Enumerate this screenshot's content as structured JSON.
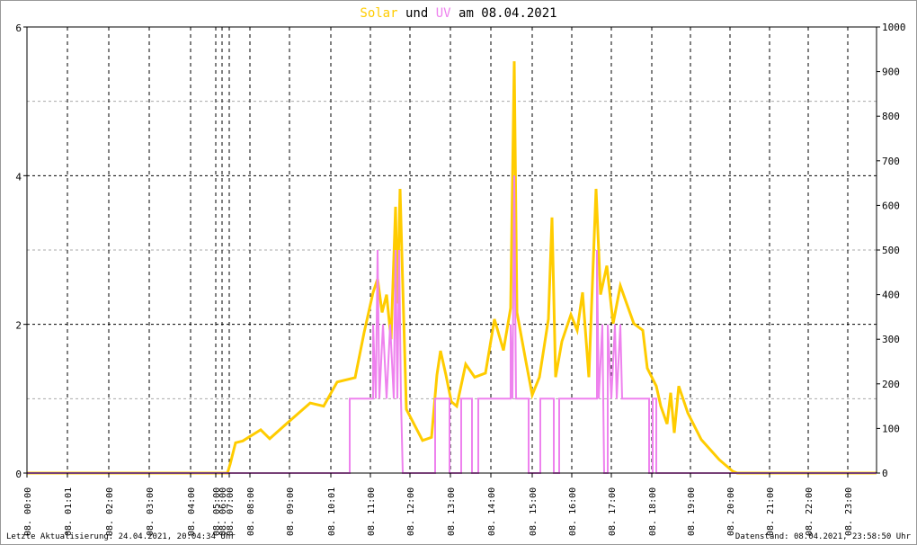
{
  "chart_data": {
    "type": "line",
    "title": {
      "parts": [
        "Solar",
        "und",
        "UV",
        "am 08.04.2021"
      ]
    },
    "x_unit": "sample index (0-945, irregular time axis)",
    "xlim": [
      0,
      945
    ],
    "x_ticks": [
      "08. 00:00",
      "08. 01:01",
      "08. 02:00",
      "08. 03:00",
      "08. 04:00",
      "08. 05:00",
      "08. 06:00",
      "08. 07:00",
      "08. 08:00",
      "08. 09:00",
      "08. 10:01",
      "08. 11:00",
      "08. 12:00",
      "08. 13:00",
      "08. 14:00",
      "08. 15:00",
      "08. 16:00",
      "08. 17:00",
      "08. 18:00",
      "08. 19:00",
      "08. 20:00",
      "08. 21:00",
      "08. 22:00",
      "08. 23:00"
    ],
    "x_tick_index": [
      0,
      45,
      91,
      136,
      182,
      210,
      217,
      225,
      248,
      292,
      338,
      382,
      426,
      471,
      516,
      562,
      606,
      650,
      695,
      738,
      782,
      826,
      869,
      913
    ],
    "y_left": {
      "label": "UV",
      "ylim": [
        0,
        6
      ],
      "ticks": [
        "0",
        "2",
        "4",
        "6"
      ]
    },
    "y_right": {
      "label": "Solar",
      "ylim": [
        0,
        1000
      ],
      "ticks": [
        "0",
        "100",
        "200",
        "300",
        "400",
        "500",
        "600",
        "700",
        "800",
        "900",
        "1000"
      ]
    },
    "series": [
      {
        "name": "Solar",
        "axis": "right",
        "color": "#ffcc00",
        "points": [
          [
            0,
            0
          ],
          [
            223,
            0
          ],
          [
            226,
            20
          ],
          [
            232,
            68
          ],
          [
            240,
            72
          ],
          [
            260,
            97
          ],
          [
            270,
            77
          ],
          [
            290,
            113
          ],
          [
            315,
            157
          ],
          [
            330,
            150
          ],
          [
            345,
            204
          ],
          [
            365,
            214
          ],
          [
            375,
            315
          ],
          [
            385,
            405
          ],
          [
            390,
            435
          ],
          [
            395,
            360
          ],
          [
            400,
            400
          ],
          [
            405,
            300
          ],
          [
            410,
            597
          ],
          [
            412,
            380
          ],
          [
            415,
            637
          ],
          [
            418,
            420
          ],
          [
            422,
            143
          ],
          [
            440,
            73
          ],
          [
            450,
            80
          ],
          [
            456,
            220
          ],
          [
            460,
            274
          ],
          [
            466,
            220
          ],
          [
            472,
            160
          ],
          [
            478,
            150
          ],
          [
            488,
            244
          ],
          [
            498,
            215
          ],
          [
            510,
            224
          ],
          [
            520,
            345
          ],
          [
            530,
            275
          ],
          [
            538,
            370
          ],
          [
            542,
            923
          ],
          [
            545,
            360
          ],
          [
            555,
            250
          ],
          [
            562,
            175
          ],
          [
            570,
            215
          ],
          [
            580,
            345
          ],
          [
            584,
            573
          ],
          [
            588,
            215
          ],
          [
            595,
            295
          ],
          [
            605,
            355
          ],
          [
            612,
            320
          ],
          [
            618,
            405
          ],
          [
            625,
            215
          ],
          [
            633,
            637
          ],
          [
            638,
            400
          ],
          [
            645,
            465
          ],
          [
            652,
            335
          ],
          [
            660,
            420
          ],
          [
            675,
            335
          ],
          [
            685,
            320
          ],
          [
            690,
            235
          ],
          [
            700,
            195
          ],
          [
            705,
            150
          ],
          [
            712,
            110
          ],
          [
            716,
            180
          ],
          [
            720,
            90
          ],
          [
            725,
            195
          ],
          [
            735,
            135
          ],
          [
            750,
            75
          ],
          [
            770,
            30
          ],
          [
            785,
            4
          ],
          [
            790,
            0
          ],
          [
            945,
            0
          ]
        ]
      },
      {
        "name": "UV",
        "axis": "left",
        "color": "#ee82ee",
        "points": [
          [
            0,
            0
          ],
          [
            359,
            0
          ],
          [
            359,
            1
          ],
          [
            385,
            1
          ],
          [
            385,
            2
          ],
          [
            388,
            1
          ],
          [
            390,
            3
          ],
          [
            392,
            1
          ],
          [
            396,
            2
          ],
          [
            400,
            1
          ],
          [
            404,
            2
          ],
          [
            408,
            1
          ],
          [
            410,
            3
          ],
          [
            412,
            1
          ],
          [
            414,
            3
          ],
          [
            416,
            1
          ],
          [
            418,
            0
          ],
          [
            454,
            0
          ],
          [
            454,
            1
          ],
          [
            470,
            1
          ],
          [
            470,
            0
          ],
          [
            483,
            0
          ],
          [
            483,
            1
          ],
          [
            495,
            1
          ],
          [
            495,
            0
          ],
          [
            502,
            0
          ],
          [
            502,
            1
          ],
          [
            538,
            1
          ],
          [
            538,
            2
          ],
          [
            540,
            1
          ],
          [
            542,
            4
          ],
          [
            544,
            1
          ],
          [
            558,
            1
          ],
          [
            558,
            0
          ],
          [
            571,
            0
          ],
          [
            571,
            1
          ],
          [
            586,
            1
          ],
          [
            586,
            0
          ],
          [
            592,
            0
          ],
          [
            592,
            1
          ],
          [
            634,
            1
          ],
          [
            634,
            3
          ],
          [
            636,
            1
          ],
          [
            640,
            2
          ],
          [
            642,
            0
          ],
          [
            646,
            0
          ],
          [
            646,
            2
          ],
          [
            650,
            1
          ],
          [
            654,
            2
          ],
          [
            656,
            1
          ],
          [
            660,
            2
          ],
          [
            662,
            1
          ],
          [
            692,
            1
          ],
          [
            692,
            0
          ],
          [
            696,
            0
          ],
          [
            696,
            1
          ],
          [
            700,
            1
          ],
          [
            700,
            0
          ],
          [
            945,
            0
          ]
        ]
      }
    ]
  },
  "footer": {
    "left": "Letzte Aktualisierung: 24.04.2021, 20:04:34 Uhr",
    "right": "Datenstand: 08.04.2021, 23:58:50 Uhr"
  }
}
